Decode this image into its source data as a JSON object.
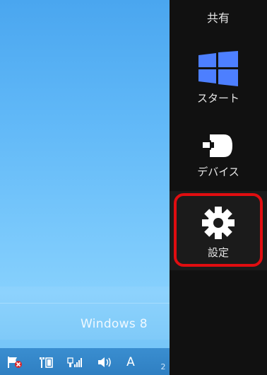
{
  "desktop": {
    "brand_text": "Windows 8"
  },
  "taskbar": {
    "tray_icons": [
      "action-center-flag-icon",
      "network-icon",
      "signal-icon",
      "volume-icon"
    ],
    "ime_label": "A",
    "clock_partial": "2"
  },
  "charms": {
    "share_label": "共有",
    "start_label": "スタート",
    "devices_label": "デバイス",
    "settings_label": "設定"
  },
  "colors": {
    "charms_bg": "#111111",
    "highlight": "#e00d10",
    "start_logo": "#4d7fff",
    "desktop_sky": "#5fb7f7"
  }
}
